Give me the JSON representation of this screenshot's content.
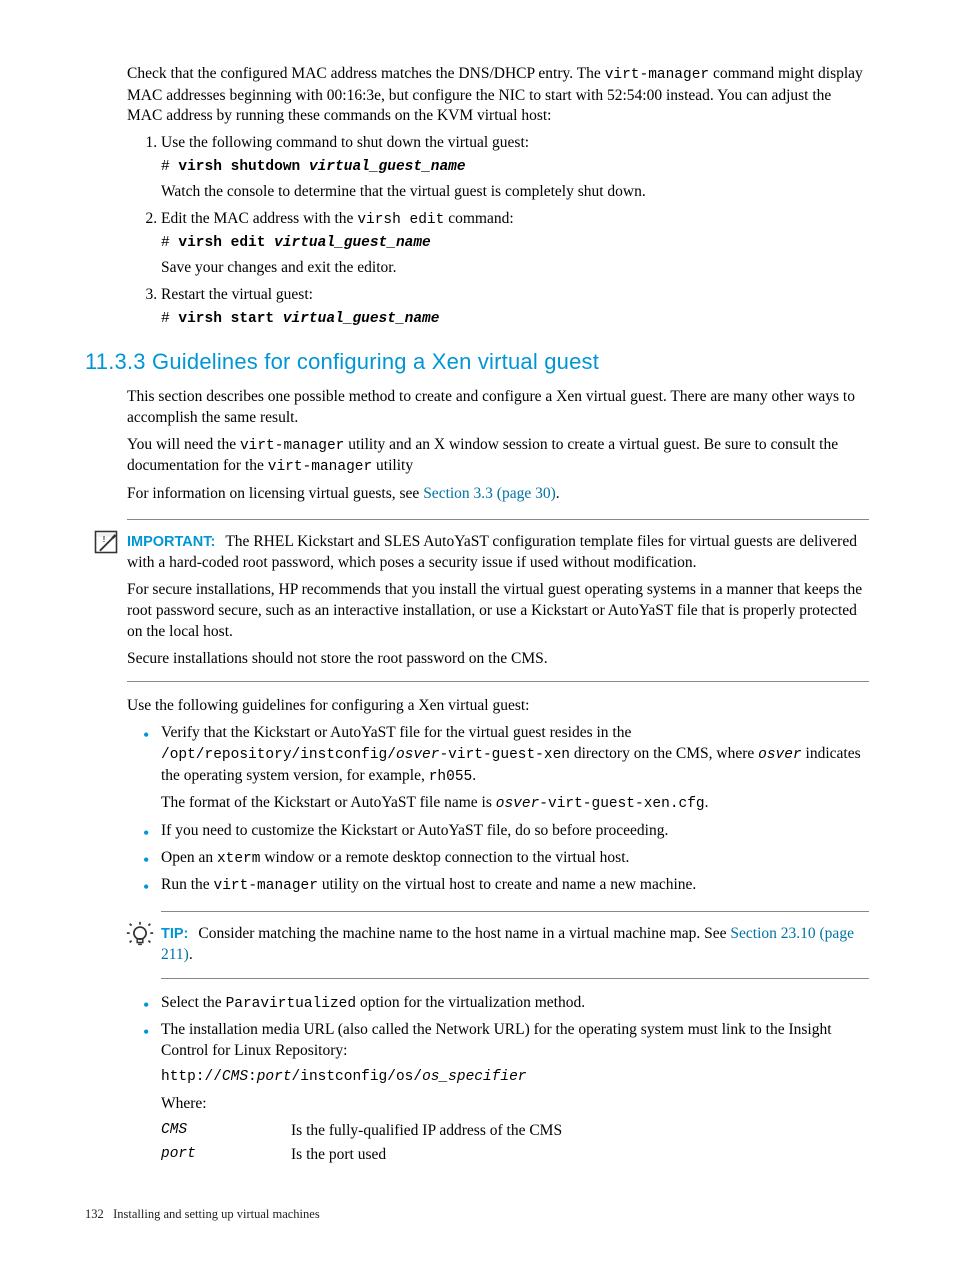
{
  "intro": {
    "p1a": "Check that the configured MAC address matches the DNS/DHCP entry. The ",
    "code1": "virt-manager",
    "p1b": " command might display MAC addresses beginning with 00:16:3e, but configure the NIC to start with 52:54:00 instead. You can adjust the MAC address by running these commands on the KVM virtual host:"
  },
  "steps": {
    "s1": {
      "text": "Use the following command to shut down the virtual guest:",
      "prompt": "# ",
      "cmd": "virsh shutdown ",
      "arg": "virtual_guest_name",
      "after": "Watch the console to determine that the virtual guest is completely shut down."
    },
    "s2": {
      "text_a": "Edit the MAC address with the ",
      "code": "virsh edit",
      "text_b": " command:",
      "prompt": "# ",
      "cmd": "virsh edit ",
      "arg": "virtual_guest_name",
      "after": "Save your changes and exit the editor."
    },
    "s3": {
      "text": "Restart the virtual guest:",
      "prompt": "# ",
      "cmd": "virsh start ",
      "arg": "virtual_guest_name"
    }
  },
  "heading": "11.3.3 Guidelines for configuring a Xen virtual guest",
  "section": {
    "p1": "This section describes one possible method to create and configure a Xen virtual guest. There are many other ways to accomplish the same result.",
    "p2a": "You will need the ",
    "p2code1": "virt-manager",
    "p2b": " utility and an X window session to create a virtual guest. Be sure to consult the documentation for the ",
    "p2code2": "virt-manager",
    "p2c": " utility",
    "p3a": "For information on licensing virtual guests, see ",
    "p3link": "Section 3.3 (page 30)",
    "p3b": "."
  },
  "important": {
    "label": "IMPORTANT:",
    "p1": "The RHEL Kickstart and SLES AutoYaST configuration template files for virtual guests are delivered with a hard-coded root password, which poses a security issue if used without modification.",
    "p2": "For secure installations, HP recommends that you install the virtual guest operating systems in a manner that keeps the root password secure, such as an interactive installation, or use a Kickstart or AutoYaST file that is properly protected on the local host.",
    "p3": "Secure installations should not store the root password on the CMS."
  },
  "after_important": "Use the following guidelines for configuring a Xen virtual guest:",
  "bullets1": {
    "b1a": "Verify that the Kickstart or AutoYaST file for the virtual guest resides in the ",
    "b1code1": "/opt/repository/instconfig/",
    "b1arg1": "osver",
    "b1code2": "-virt-guest-xen",
    "b1b": " directory on the CMS, where ",
    "b1arg2": "osver",
    "b1c": " indicates the operating system version, for example, ",
    "b1code3": "rh055",
    "b1d": ".",
    "b1p2a": "The format of the Kickstart or AutoYaST file name is ",
    "b1p2arg": "osver",
    "b1p2code": "-virt-guest-xen.cfg",
    "b1p2b": ".",
    "b2": "If you need to customize the Kickstart or AutoYaST file, do so before proceeding.",
    "b3a": "Open an ",
    "b3code": "xterm",
    "b3b": " window or a remote desktop connection to the virtual host.",
    "b4a": "Run the ",
    "b4code": "virt-manager",
    "b4b": " utility on the virtual host to create and name a new machine."
  },
  "tip": {
    "label": "TIP:",
    "text_a": "Consider matching the machine name to the host name in a virtual machine map. See ",
    "link": "Section 23.10 (page 211)",
    "text_b": "."
  },
  "bullets2": {
    "b1a": "Select the ",
    "b1code": "Paravirtualized",
    "b1b": " option for the virtualization method.",
    "b2": "The installation media URL (also called the Network URL) for the operating system must link to the Insight Control for Linux Repository:",
    "url1": "http://",
    "url_cms": "CMS",
    "url_colon": ":",
    "url_port": "port",
    "url2": "/instconfig/os/",
    "url_os": "os_specifier",
    "where": "Where:",
    "def_cms_term": "CMS",
    "def_cms_body": "Is the fully-qualified IP address of the CMS",
    "def_port_term": "port",
    "def_port_body": "Is the port used"
  },
  "footer": {
    "page": "132",
    "title": "Installing and setting up virtual machines"
  }
}
